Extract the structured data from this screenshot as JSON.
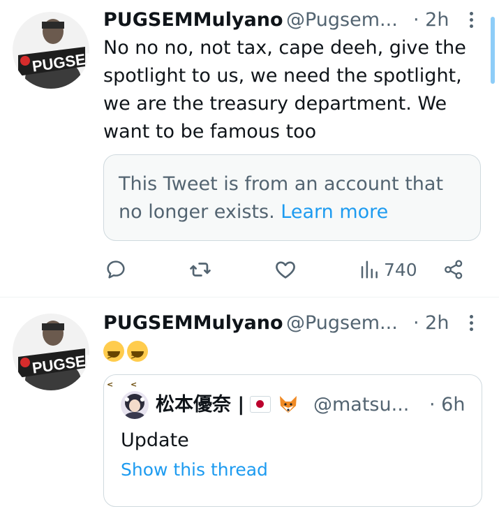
{
  "tweets": [
    {
      "name": "PUGSEMMulyano",
      "handle": "@Pugsem...",
      "time": "· 2h",
      "avatar_text": "PUGSEM",
      "lines": [
        "No no no, not tax, cape deeh, give the",
        "spotlight to us, we need the spotlight,",
        "we are the treasury department. We",
        "want to be famous too"
      ],
      "notice": {
        "line1": "This Tweet is from an account that",
        "line2_prefix": "no longer exists. ",
        "link": "Learn more"
      },
      "actions": {
        "reply_icon": "reply-icon",
        "retweet_icon": "retweet-icon",
        "like_icon": "heart-icon",
        "views_icon": "views-icon",
        "views": "740",
        "share_icon": "share-icon"
      }
    },
    {
      "name": "PUGSEMMulyano",
      "handle": "@Pugsem...",
      "time": "· 2h",
      "avatar_text": "PUGSEM",
      "emoji": "😆😆",
      "quote": {
        "name": "松本優奈 |",
        "handle": "@matsu...",
        "time": "· 6h",
        "text": "Update",
        "link": "Show this thread"
      }
    }
  ],
  "colors": {
    "link": "#1d9bf0",
    "secondary": "#536471",
    "border": "#cfd9de"
  }
}
